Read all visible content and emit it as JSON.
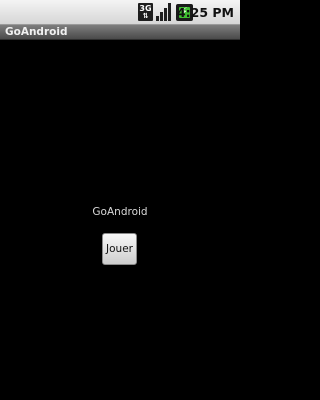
{
  "status_bar": {
    "network_type": "3G",
    "network_activity": "⇅",
    "time": "4:25 PM",
    "icons": [
      "network-3g-icon",
      "signal-strength-icon",
      "battery-charging-icon"
    ],
    "colors": {
      "battery_fill": "#3fbf30"
    }
  },
  "title_bar": {
    "title": "GoAndroid"
  },
  "main": {
    "label": "GoAndroid",
    "play_button_label": "Jouer"
  }
}
